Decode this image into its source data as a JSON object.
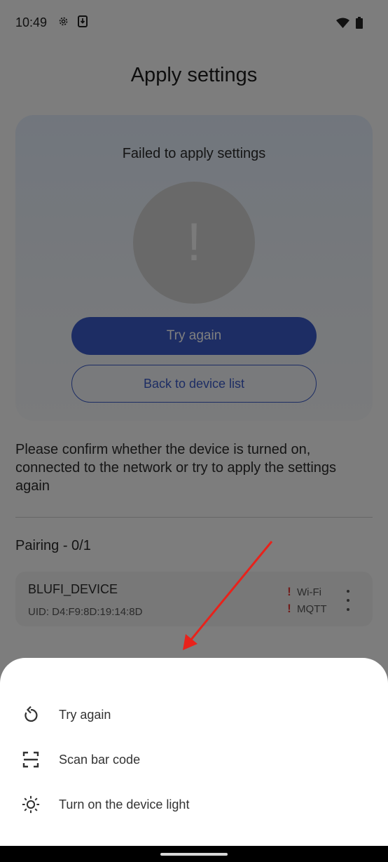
{
  "status_bar": {
    "time": "10:49"
  },
  "page": {
    "title": "Apply settings"
  },
  "result_card": {
    "heading": "Failed to apply settings",
    "error_symbol": "!",
    "primary_button": "Try again",
    "secondary_button": "Back to device list"
  },
  "info_text": "Please confirm whether the device is turned on, connected to the network or try to apply the settings again",
  "pairing": {
    "title": "Pairing - 0/1",
    "devices": [
      {
        "name": "BLUFI_DEVICE",
        "uid": "UID: D4:F9:8D:19:14:8D",
        "statuses": [
          {
            "mark": "!",
            "label": "Wi-Fi"
          },
          {
            "mark": "!",
            "label": "MQTT"
          }
        ]
      }
    ]
  },
  "bottom_sheet": {
    "items": [
      {
        "label": "Try again",
        "icon": "retry-icon"
      },
      {
        "label": "Scan bar code",
        "icon": "barcode-scan-icon"
      },
      {
        "label": "Turn on the device light",
        "icon": "light-icon"
      }
    ]
  },
  "colors": {
    "primary": "#3a5ac9",
    "error": "#e53935",
    "annotation_arrow": "#e8221b"
  }
}
